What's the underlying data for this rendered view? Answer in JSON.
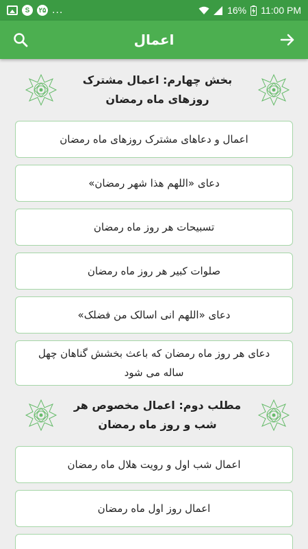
{
  "status_bar": {
    "battery": "16%",
    "time": "11:00 PM",
    "left_badge": "۲۵",
    "ellipsis": "..."
  },
  "header": {
    "title": "اعمال",
    "back_icon": "arrow-right-icon",
    "search_icon": "search-icon"
  },
  "colors": {
    "status_bar": "#3b9b43",
    "app_bar": "#4caf50",
    "card_border": "#a5d6a7",
    "ornament": "#66bb6a"
  },
  "sections": [
    {
      "title_line1": "بخش چهارم: اعمال مشترک",
      "title_line2": "روزهای ماه رمضان",
      "items": [
        "اعمال و دعاهای مشترک روزهای ماه رمضان",
        "دعای «اللهم هذا شهر رمضان»",
        "تسبیحات هر روز ماه رمضان",
        "صلوات کبیر هر روز ماه رمضان",
        "دعای «اللهم انی اسالک من فضلک»",
        "دعای هر روز ماه رمضان که باعث بخشش گناهان چهل ساله می شود"
      ]
    },
    {
      "title_line1": "مطلب دوم: اعمال مخصوص هر",
      "title_line2": "شب و روز ماه رمضان",
      "items": [
        "اعمال شب اول و رویت هلال ماه رمضان",
        "اعمال روز اول ماه رمضان",
        ""
      ]
    }
  ]
}
